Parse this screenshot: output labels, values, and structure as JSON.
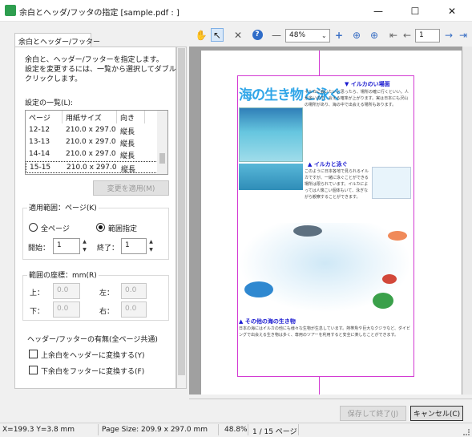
{
  "window": {
    "title": "余白とヘッダ/フッタの指定 [sample.pdf : ]",
    "minimize": "—",
    "maximize": "☐",
    "close": "✕"
  },
  "panel": {
    "tab": "余白とヘッダー/フッター",
    "intro": [
      "余白と、ヘッダー/フッターを指定します。",
      "設定を変更するには、一覧から選択してダブル",
      "クリックします。"
    ],
    "list_label": "設定の一覧(L):",
    "list_headers": [
      "ページ",
      "用紙サイズ",
      "向き"
    ],
    "rows": [
      [
        "12-12",
        "210.0 x 297.0",
        "縦長"
      ],
      [
        "13-13",
        "210.0 x 297.0",
        "縦長"
      ],
      [
        "14-14",
        "210.0 x 297.0",
        "縦長"
      ],
      [
        "15-15",
        "210.0 x 297.0",
        "縦長"
      ]
    ],
    "apply_button": "変更を適用(M)",
    "range_group": "適用範囲：ページ(K)",
    "all_pages": "全ページ",
    "range_specify": "範囲指定",
    "start_label": "開始：",
    "start_value": "1",
    "end_label": "終了：",
    "end_value": "1",
    "margin_group": "範囲の座標：mm(R)",
    "top_label": "上：",
    "top_value": "0.0",
    "left_label": "左：",
    "left_value": "0.0",
    "bottom_label": "下：",
    "bottom_value": "0.0",
    "right_label": "右：",
    "right_value": "0.0",
    "hf_group": "ヘッダー/フッターの有無(全ページ共通)",
    "chk_header": "上余白をヘッダーに変換する(Y)",
    "chk_footer": "下余白をフッターに変換する(F)"
  },
  "toolbar": {
    "zoom": "48%",
    "page": "1"
  },
  "doc": {
    "title": "海の生き物と泳ぐ",
    "h_dolphin": "▼ イルカのい場面",
    "h_swim": "▲ イルカと泳ぐ",
    "h_other": "▲ その他の海の生き物",
    "para1": "イルカに会いたいと思ったら、場所の確に行くといい。人が多いので、会える確率が上がります。実は日本にも沢山の場所があり、海の中で出会える場所もあります。",
    "para2": "このように日本各地で見られるイルカですが、一緒に泳ぐことができる場所は限られています。イルカによっては人懐こい個体もいて、泳ぎながら観察することができます。",
    "para3": "日本の海にはイルカの他にも様々な生物が生息しています。熱帯魚や巨大なクジラなど、ダイビングで出会える生き物は多く、専用のツアーを利用すると安全に楽しむことができます。"
  },
  "buttons": {
    "save": "保存して終了(J)",
    "cancel": "キャンセル(C)"
  },
  "status": {
    "coords": "X=199.3 Y=3.8 mm",
    "page_size": "Page Size: 209.9 x 297.0 mm",
    "zoom": "48.8%",
    "pages": "1 / 15 ページ"
  }
}
